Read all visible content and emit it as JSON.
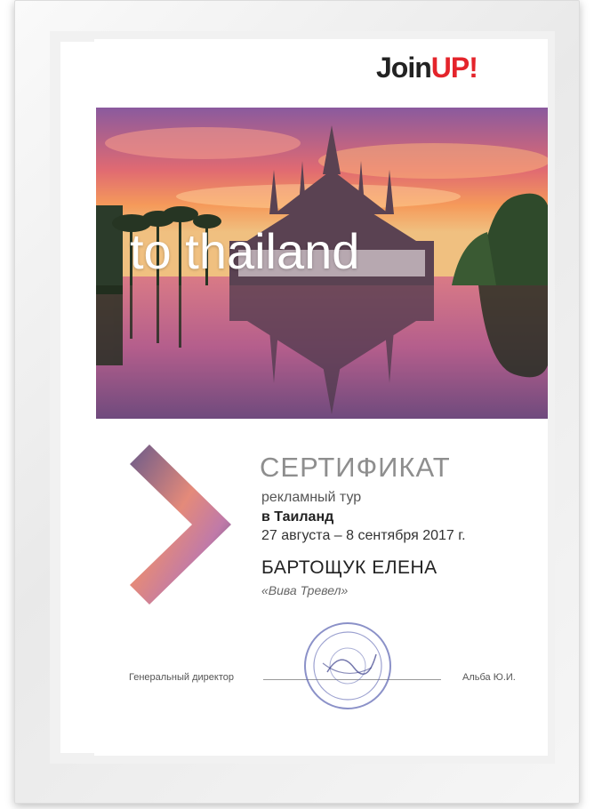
{
  "brand": {
    "logo_text_1": "Join",
    "logo_text_2": "UP!"
  },
  "photo": {
    "caption": "to thailand"
  },
  "certificate": {
    "title": "СЕРТИФИКАТ",
    "line1": "рекламный тур",
    "line2": "в Таиланд",
    "dates": "27 августа – 8 сентября 2017 г.",
    "name": "БАРТОЩУК ЕЛЕНА",
    "company": "«Вива Тревел»"
  },
  "signature": {
    "position": "Генеральный директор",
    "signer": "Альба Ю.И."
  },
  "colors": {
    "accent": "#e4242b",
    "title_gray": "#8e8e8e"
  }
}
